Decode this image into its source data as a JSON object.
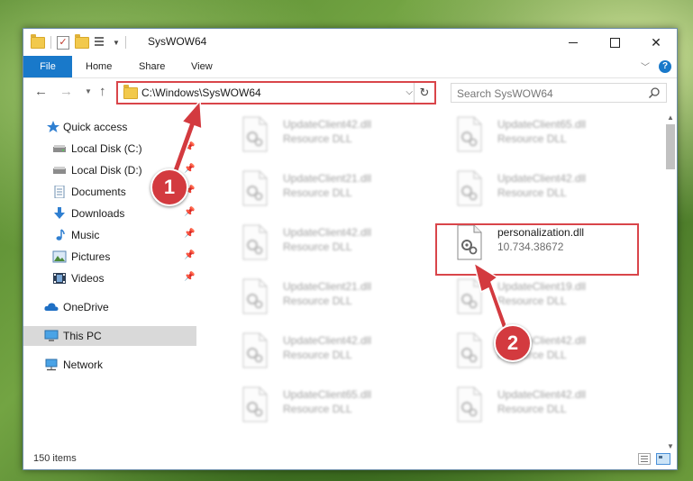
{
  "window": {
    "title": "SysWOW64",
    "controls": {
      "minimize": "minimize-icon",
      "maximize": "maximize-icon",
      "close": "✕"
    }
  },
  "ribbon": {
    "tabs": [
      "File",
      "Home",
      "Share",
      "View"
    ],
    "help": "?"
  },
  "address": {
    "path": "C:\\Windows\\SysWOW64",
    "search_placeholder": "Search SysWOW64"
  },
  "sidebar": {
    "items": [
      {
        "label": "Quick access",
        "icon": "star-icon"
      },
      {
        "label": "Local Disk (C:)",
        "icon": "drive-icon",
        "pinned": true
      },
      {
        "label": "Local Disk (D:)",
        "icon": "drive-icon",
        "pinned": true
      },
      {
        "label": "Documents",
        "icon": "documents-icon",
        "pinned": true
      },
      {
        "label": "Downloads",
        "icon": "download-icon",
        "pinned": true
      },
      {
        "label": "Music",
        "icon": "music-icon",
        "pinned": true
      },
      {
        "label": "Pictures",
        "icon": "pictures-icon",
        "pinned": true
      },
      {
        "label": "Videos",
        "icon": "videos-icon",
        "pinned": true
      },
      {
        "label": "OneDrive",
        "icon": "cloud-icon"
      },
      {
        "label": "This PC",
        "icon": "computer-icon",
        "selected": true
      },
      {
        "label": "Network",
        "icon": "network-icon"
      }
    ]
  },
  "files": [
    {
      "name": "UpdateClient42.dll",
      "type": "Resource DLL"
    },
    {
      "name": "UpdateClient65.dll",
      "type": "Resource DLL"
    },
    {
      "name": "UpdateClient21.dll",
      "type": "Resource DLL"
    },
    {
      "name": "UpdateClient42.dll",
      "type": "Resource DLL"
    },
    {
      "name": "UpdateClient42.dll",
      "type": "Resource DLL"
    },
    {
      "name": "personalization.dll",
      "type": "10.734.38672"
    },
    {
      "name": "UpdateClient21.dll",
      "type": "Resource DLL"
    },
    {
      "name": "UpdateClient19.dll",
      "type": "Resource DLL"
    },
    {
      "name": "UpdateClient42.dll",
      "type": "Resource DLL"
    },
    {
      "name": "UpdateClient42.dll",
      "type": "Resource DLL"
    },
    {
      "name": "UpdateClient65.dll",
      "type": "Resource DLL"
    },
    {
      "name": "UpdateClient42.dll",
      "type": "Resource DLL"
    }
  ],
  "status": {
    "item_count": "150 items"
  },
  "annotations": {
    "step1": "1",
    "step2": "2",
    "color": "#d33a3f"
  },
  "colors": {
    "accent": "#1979ca",
    "highlight_box": "#d9454a",
    "selected_nav": "#d9d9d9"
  }
}
